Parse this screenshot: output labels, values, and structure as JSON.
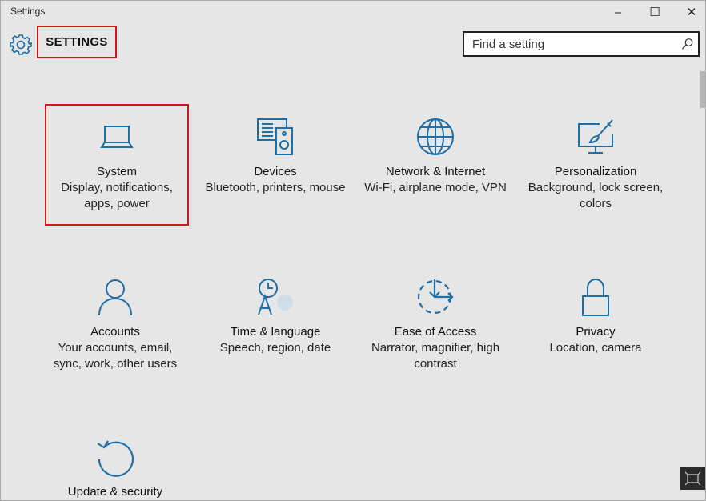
{
  "window": {
    "title": "Settings",
    "controls": {
      "minimize": "–",
      "maximize": "☐",
      "close": "✕"
    }
  },
  "header": {
    "icon": "gear-icon",
    "title": "SETTINGS",
    "search": {
      "placeholder": "Find a setting",
      "value": "",
      "icon": "search-icon"
    }
  },
  "accent_color": "#1d6fa5",
  "highlight_color": "#d4141c",
  "categories": [
    {
      "name": "System",
      "desc": "Display, notifications, apps, power",
      "icon": "laptop-icon",
      "selected": true
    },
    {
      "name": "Devices",
      "desc": "Bluetooth, printers, mouse",
      "icon": "devices-icon"
    },
    {
      "name": "Network & Internet",
      "desc": "Wi-Fi, airplane mode, VPN",
      "icon": "globe-icon"
    },
    {
      "name": "Personalization",
      "desc": "Background, lock screen, colors",
      "icon": "paint-monitor-icon"
    },
    {
      "name": "Accounts",
      "desc": "Your accounts, email, sync, work, other users",
      "icon": "person-icon"
    },
    {
      "name": "Time & language",
      "desc": "Speech, region, date",
      "icon": "time-language-icon"
    },
    {
      "name": "Ease of Access",
      "desc": "Narrator, magnifier, high contrast",
      "icon": "ease-of-access-icon"
    },
    {
      "name": "Privacy",
      "desc": "Location, camera",
      "icon": "lock-icon"
    },
    {
      "name": "Update & security",
      "desc": "",
      "icon": "refresh-icon"
    }
  ]
}
